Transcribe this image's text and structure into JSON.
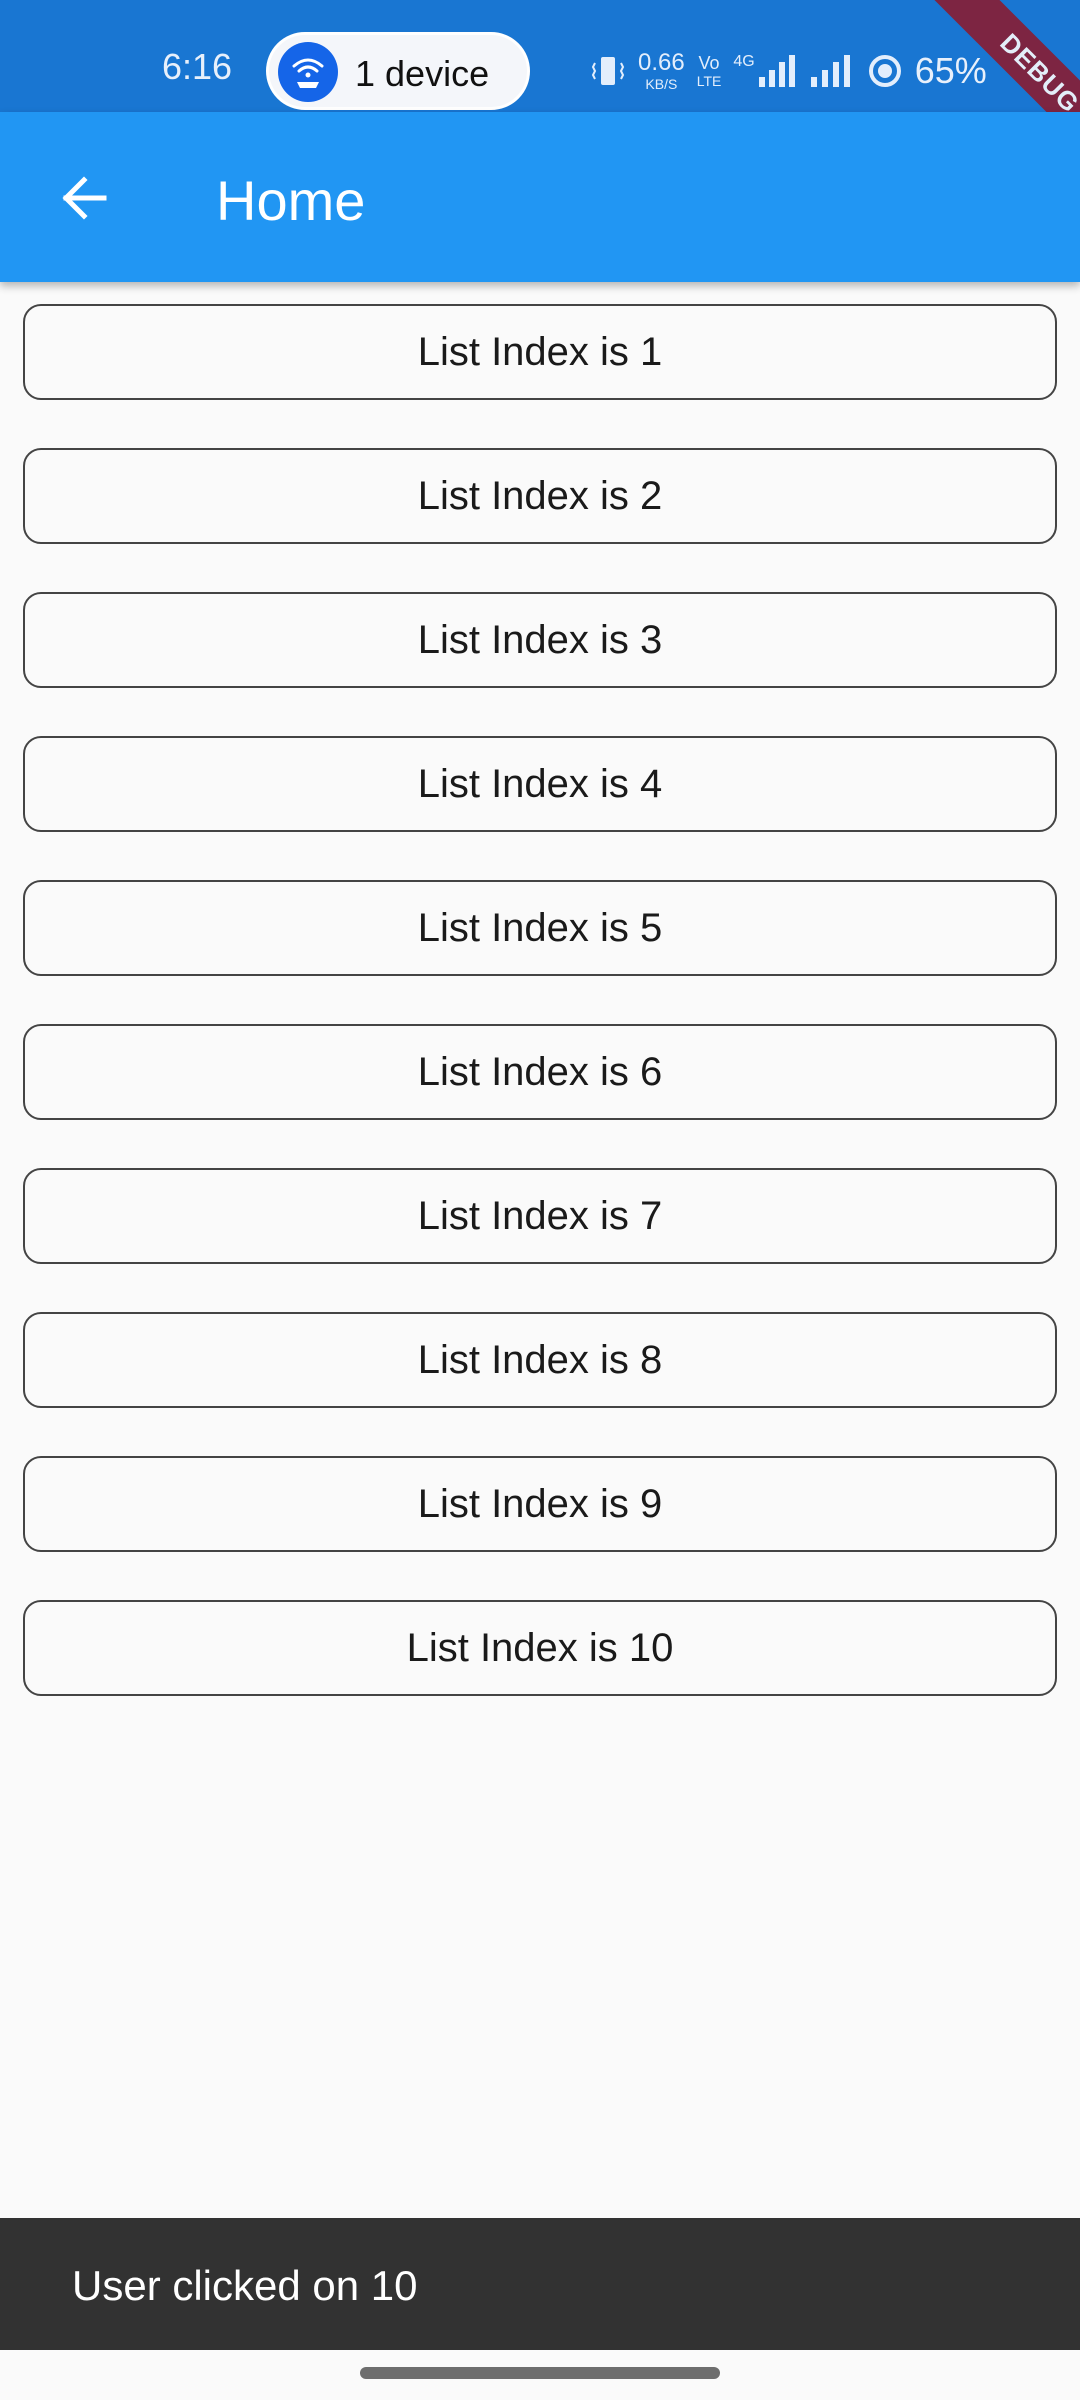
{
  "status_bar": {
    "time": "6:16",
    "hotspot_label": "1 device",
    "net_speed_value": "0.66",
    "net_speed_unit": "KB/S",
    "volte_top": "Vo",
    "volte_bottom": "LTE",
    "network_type": "4G",
    "battery_percent": "65%",
    "icons": [
      "hotspot-icon",
      "vibrate-icon",
      "signal-icon",
      "signal-icon",
      "battery-icon"
    ]
  },
  "debug_banner": "DEBUG",
  "app_bar": {
    "title": "Home",
    "back_icon": "arrow-back-icon"
  },
  "list": {
    "items": [
      "List Index is 1",
      "List Index is 2",
      "List Index is 3",
      "List Index is 4",
      "List Index is 5",
      "List Index is 6",
      "List Index is 7",
      "List Index is 8",
      "List Index is 9",
      "List Index is 10"
    ]
  },
  "snackbar": {
    "message": "User clicked on 10"
  },
  "colors": {
    "status_bar": "#1976d2",
    "app_bar": "#2196f3",
    "background": "#fafafa",
    "snackbar": "#323232",
    "debug_banner": "#8b1a2f"
  }
}
